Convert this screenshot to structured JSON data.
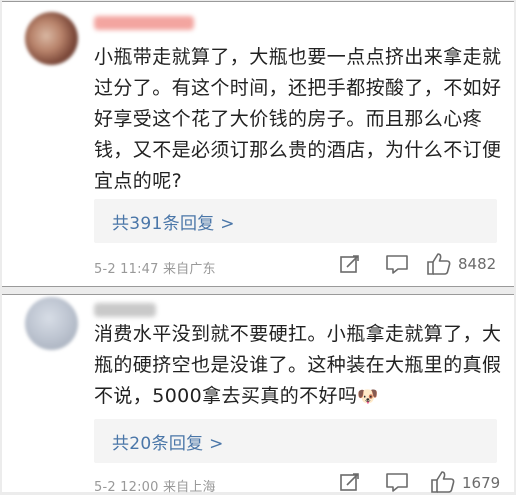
{
  "comments": [
    {
      "text": "小瓶带走就算了，大瓶也要一点点挤出来拿走就过分了。有这个时间，还把手都按酸了，不如好好享受这个花了大价钱的房子。而且那么心疼钱，又不是必须订那么贵的酒店，为什么不订便宜点的呢?",
      "replies_label": "共391条回复 >",
      "meta": "5-2 11:47 来自广东",
      "like_count": "8482"
    },
    {
      "text": "消费水平没到就不要硬扛。小瓶拿走就算了，大瓶的硬挤空也是没谁了。这种装在大瓶里的真假不说，5000拿去买真的不好吗",
      "emoji": "🐶",
      "replies_label": "共20条回复 >",
      "meta": "5-2 12:00 来自上海",
      "like_count": "1679"
    }
  ],
  "icons": {
    "share": "share-edit-icon",
    "comment": "comment-bubble-icon",
    "like": "thumbs-up-icon"
  },
  "colors": {
    "link_blue": "#4a76a8",
    "meta_gray": "#999999",
    "reply_box": "#f4f4f4"
  }
}
